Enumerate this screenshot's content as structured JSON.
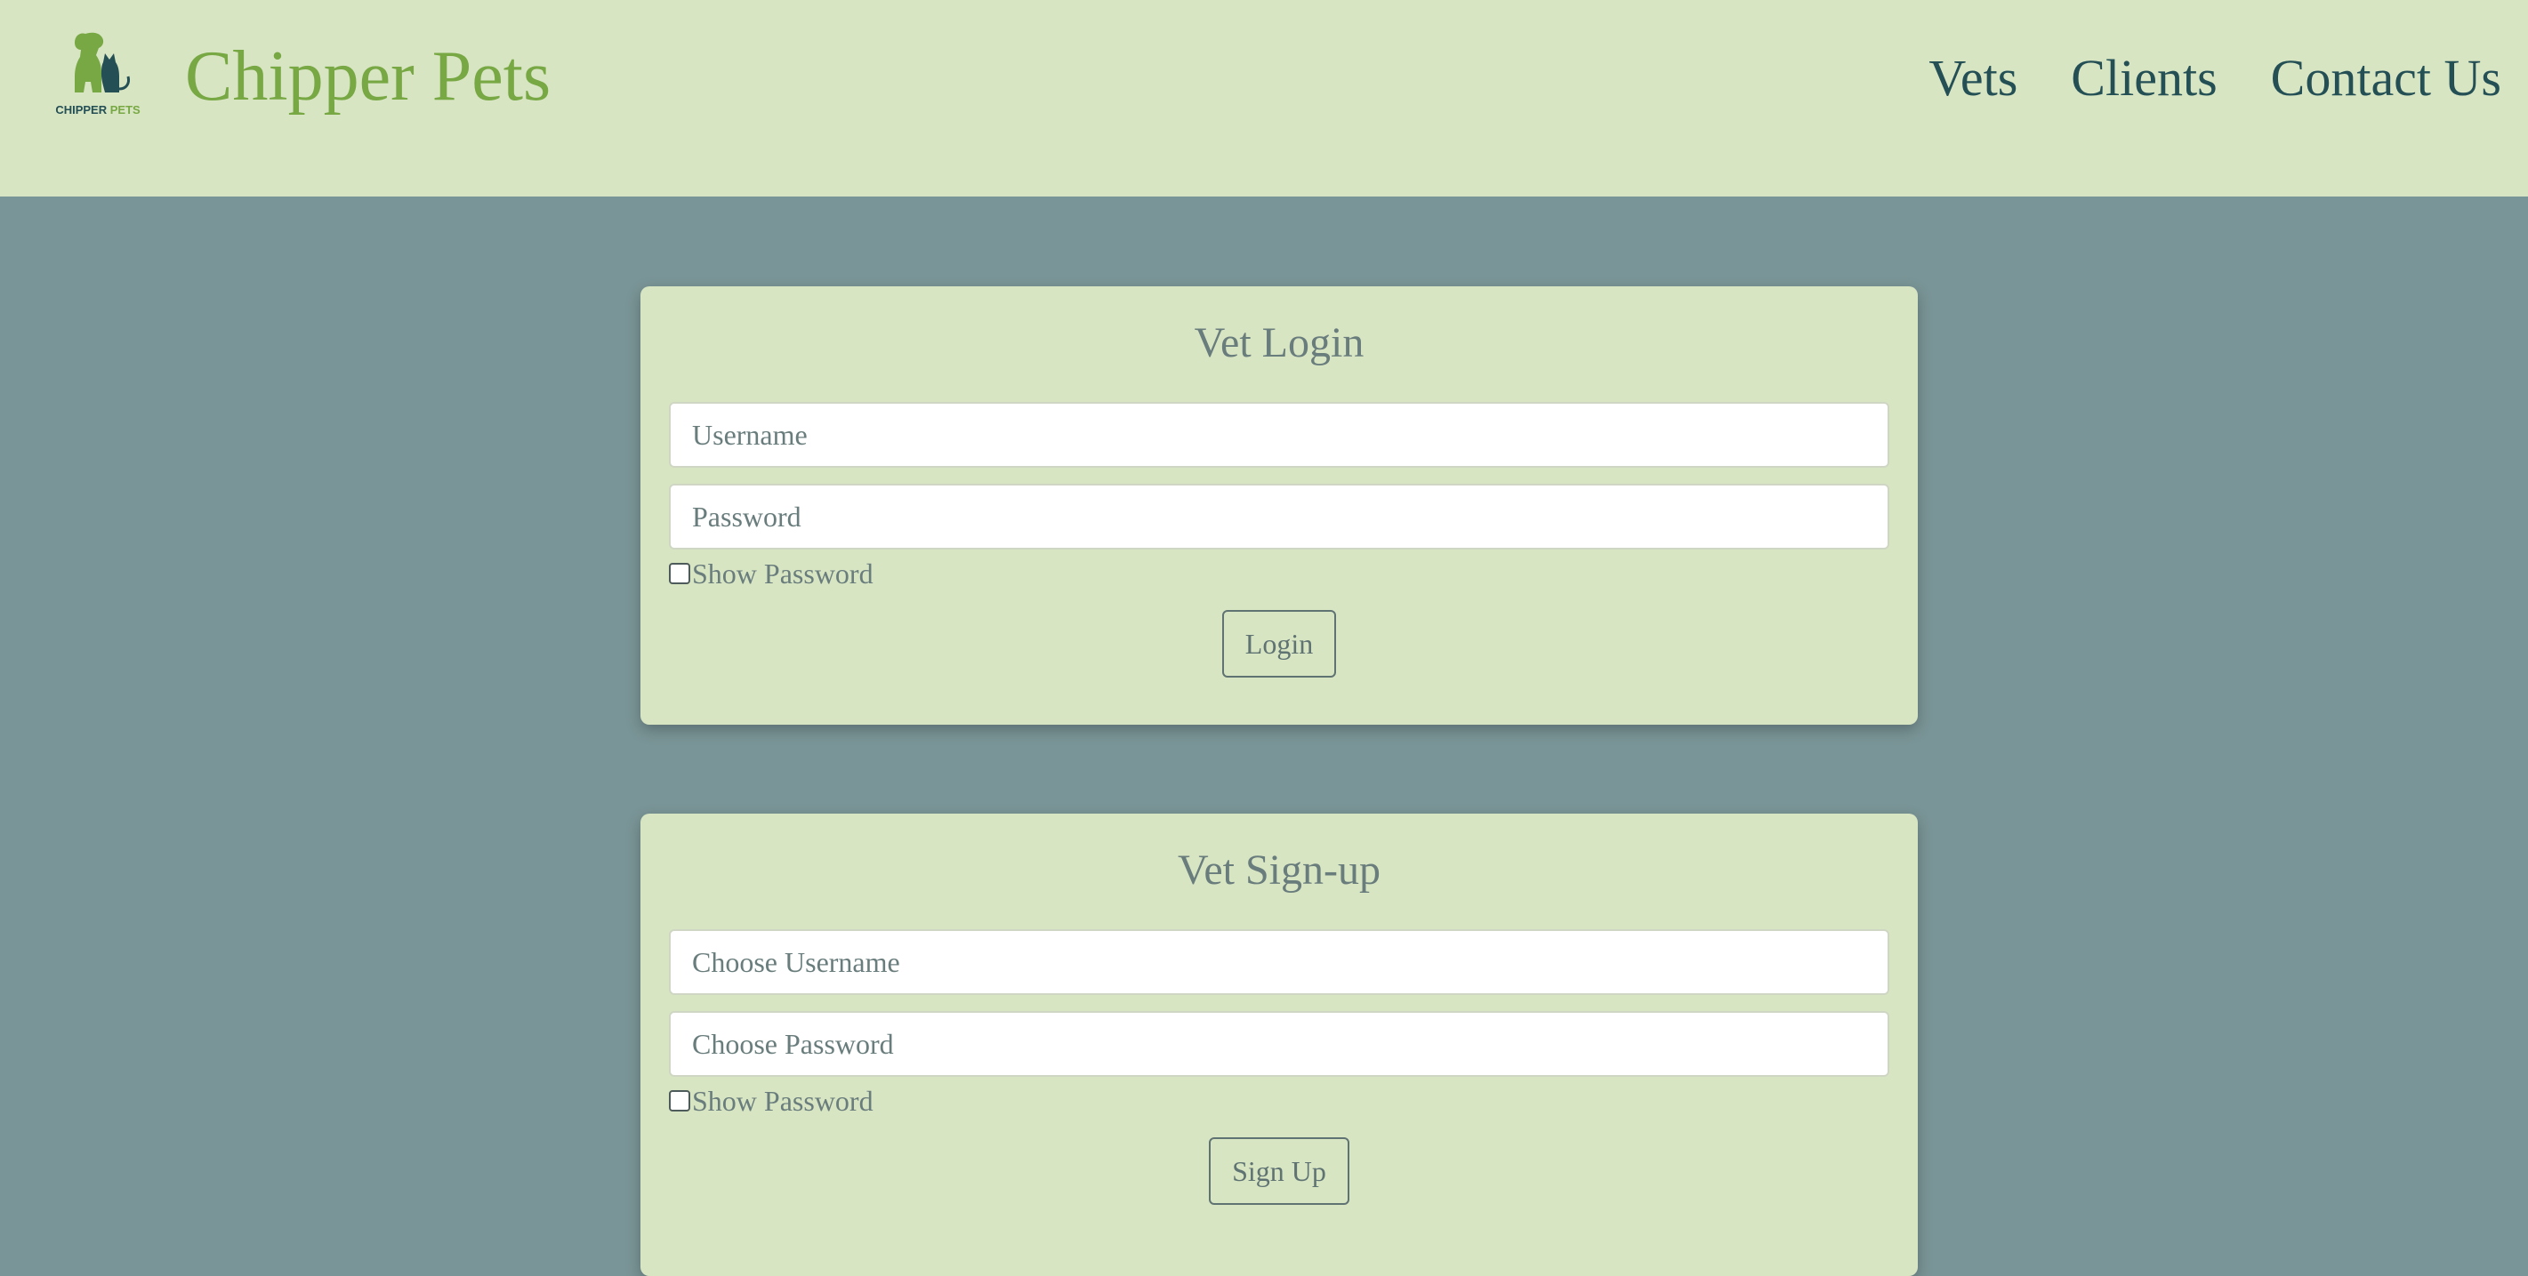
{
  "header": {
    "logo_text": "CHIPPER PETS",
    "brand": "Chipper Pets",
    "nav": {
      "vets": "Vets",
      "clients": "Clients",
      "contact": "Contact Us"
    }
  },
  "login_card": {
    "title": "Vet Login",
    "username_placeholder": "Username",
    "password_placeholder": "Password",
    "show_password_label": "Show Password",
    "button_label": "Login"
  },
  "signup_card": {
    "title": "Vet Sign-up",
    "username_placeholder": "Choose Username",
    "password_placeholder": "Choose Password",
    "show_password_label": "Show Password",
    "button_label": "Sign Up"
  },
  "colors": {
    "header_bg": "#d8e5c3",
    "page_bg": "#7a9597",
    "brand": "#77a844",
    "nav_text": "#234f55",
    "card_bg": "#d8e5c3",
    "muted_text": "#6a7d7d"
  },
  "icons": {
    "logo": "dog-and-cat-logo-icon"
  }
}
